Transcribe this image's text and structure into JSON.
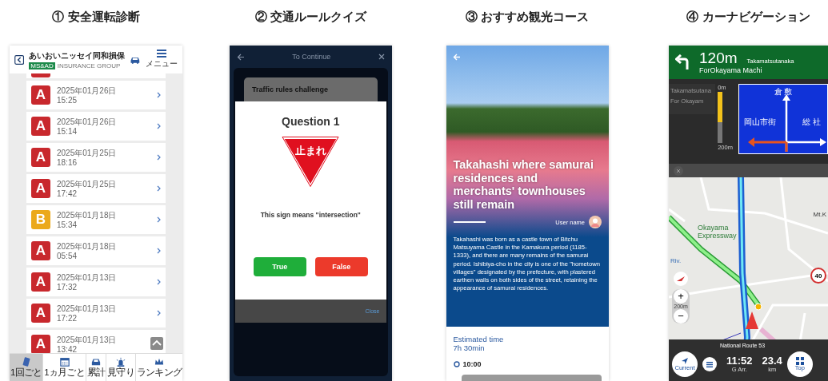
{
  "captions": [
    "① 安全運転診断",
    "② 交通ルールクイズ",
    "③ おすすめ観光コース",
    "④ カーナビゲーション"
  ],
  "safety": {
    "title": "あいおいニッセイ同和損保",
    "brand": "MS&AD",
    "subtitle": "INSURANCE GROUP",
    "menu_label": "メニュー",
    "records": [
      {
        "grade": "A",
        "color": "#c8282d",
        "date": "2025年01月26日",
        "time": "15:25"
      },
      {
        "grade": "A",
        "color": "#c8282d",
        "date": "2025年01月26日",
        "time": "15:14"
      },
      {
        "grade": "A",
        "color": "#c8282d",
        "date": "2025年01月25日",
        "time": "18:16"
      },
      {
        "grade": "A",
        "color": "#c8282d",
        "date": "2025年01月25日",
        "time": "17:42"
      },
      {
        "grade": "B",
        "color": "#eba91b",
        "date": "2025年01月18日",
        "time": "15:34"
      },
      {
        "grade": "A",
        "color": "#c8282d",
        "date": "2025年01月18日",
        "time": "05:54"
      },
      {
        "grade": "A",
        "color": "#c8282d",
        "date": "2025年01月13日",
        "time": "17:32"
      },
      {
        "grade": "A",
        "color": "#c8282d",
        "date": "2025年01月13日",
        "time": "17:22"
      },
      {
        "grade": "A",
        "color": "#c8282d",
        "date": "2025年01月13日",
        "time": "13:42"
      }
    ],
    "nav": [
      {
        "label": "1回ごと",
        "kind": "phone",
        "selected": true
      },
      {
        "label": "1ヵ月ごと",
        "kind": "calendar",
        "selected": false
      },
      {
        "label": "累計",
        "kind": "car",
        "selected": false
      },
      {
        "label": "見守り",
        "kind": "siren",
        "selected": false
      },
      {
        "label": "ランキング",
        "kind": "crown",
        "selected": false
      }
    ]
  },
  "quiz": {
    "header": "To Continue",
    "card_title": "Traffic rules challenge",
    "question": "Question 1",
    "sign_text": "止まれ",
    "statement": "This sign means \"intersection\"",
    "answers": [
      {
        "label": "True",
        "kind": "true"
      },
      {
        "label": "False",
        "kind": "false"
      }
    ],
    "close": "Close"
  },
  "tour": {
    "title": "Takahashi where samurai residences and merchants' townhouses still remain",
    "author": "User name",
    "description": "Takahashi was born as a castle town of Bitchu Matsuyama Castle in the Kamakura period (1185-1333), and there are many remains of the samurai period. Ishibiya-cho in the city is one of the \"hometown villages\" designated by the prefecture, with plastered earthen walls on both sides of the street, retaining the appearance of samurai residences.",
    "time_label": "Estimated time",
    "time_value": "7h 30min",
    "stops": [
      {
        "time": "10:00"
      }
    ]
  },
  "navi": {
    "distance": "120m",
    "direction": "ForOkayama Machi",
    "street": "Takamatsutanaka",
    "ghost": [
      "Takamatsutana",
      "For Okayam"
    ],
    "meter": {
      "top": "0m",
      "bottom": "200m",
      "level": 0.6
    },
    "sign": {
      "top": "倉 敷",
      "left": "岡山市街",
      "right": "総 社"
    },
    "map_labels": {
      "expressway": "Okayama Expressway",
      "mountain": "Mt.K",
      "river": "Riv.",
      "speed": "40"
    },
    "zoom_in": "+",
    "zoom_scale": "200m",
    "zoom_out": "−",
    "road": "National Route 53",
    "current": "Current",
    "arrival_time": "11:52",
    "arrival_label": "G Arr.",
    "remaining": "23.4",
    "remaining_unit": "km",
    "top": "Top"
  }
}
